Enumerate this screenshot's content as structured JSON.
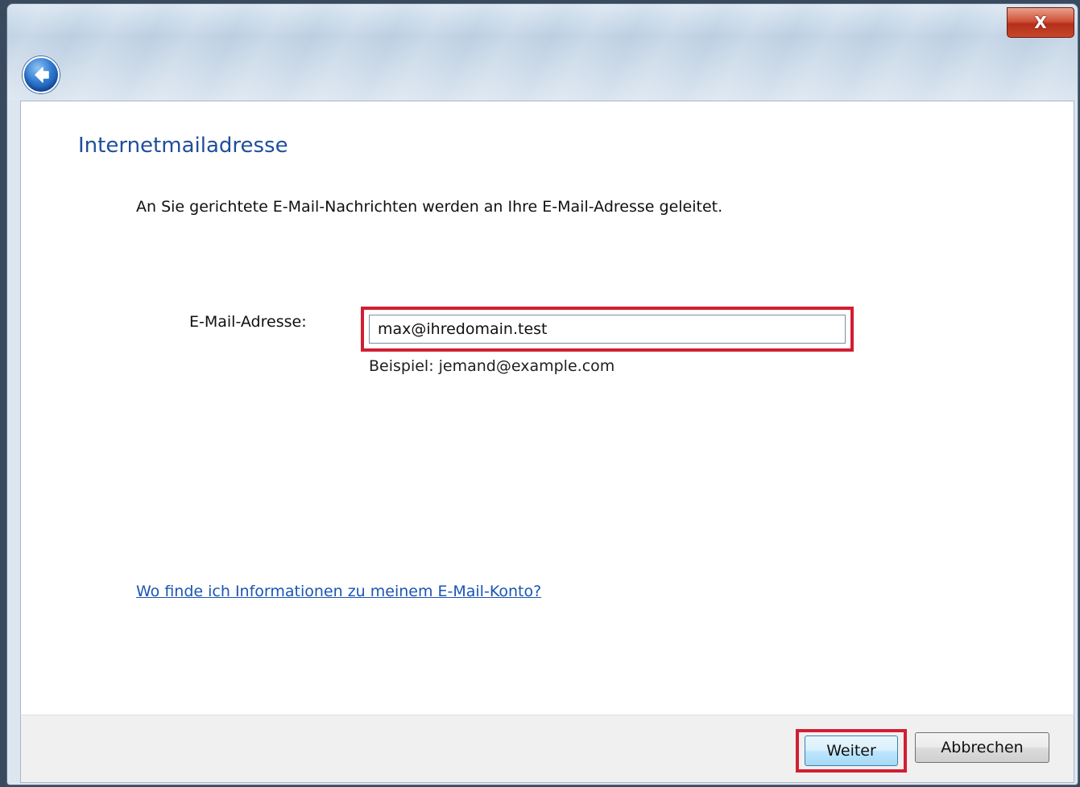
{
  "window": {
    "close_label": "X",
    "close_color": "#c8462c"
  },
  "page": {
    "title": "Internetmailadresse",
    "intro": "An Sie gerichtete E-Mail-Nachrichten werden an Ihre E-Mail-Adresse geleitet."
  },
  "form": {
    "email_label": "E-Mail-Adresse:",
    "email_value": "max@ihredomain.test",
    "example": "Beispiel: jemand@example.com"
  },
  "help": {
    "link_text": "Wo finde ich Informationen zu meinem E-Mail-Konto?"
  },
  "footer": {
    "next_label": "Weiter",
    "cancel_label": "Abbrechen"
  },
  "colors": {
    "highlight": "#d21e33",
    "title": "#1f4e9b",
    "link": "#1a55b4"
  },
  "icons": {
    "back": "back-arrow-icon",
    "close": "close-icon"
  }
}
